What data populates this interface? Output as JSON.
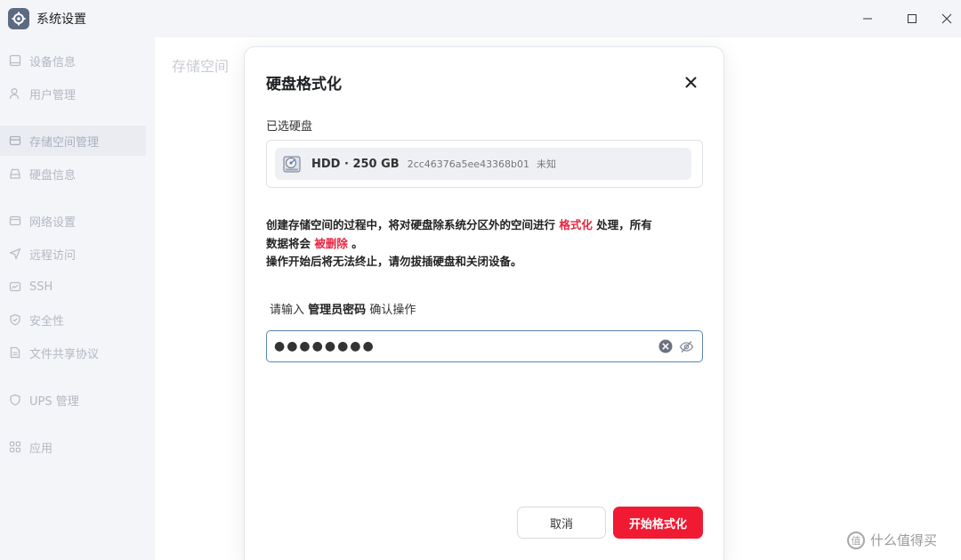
{
  "window": {
    "title": "系统设置",
    "minimize_icon": "minimize-icon",
    "maximize_icon": "maximize-icon",
    "close_icon": "close-icon"
  },
  "sidebar": {
    "items": [
      {
        "label": "设备信息",
        "icon": "device-icon",
        "active": false
      },
      {
        "label": "用户管理",
        "icon": "user-icon",
        "active": false
      },
      {
        "label": "存储空间管理",
        "icon": "storage-icon",
        "active": true
      },
      {
        "label": "硬盘信息",
        "icon": "disk-icon",
        "active": false
      },
      {
        "label": "网络设置",
        "icon": "network-icon",
        "active": false
      },
      {
        "label": "远程访问",
        "icon": "remote-access-icon",
        "active": false
      },
      {
        "label": "SSH",
        "icon": "ssh-icon",
        "active": false
      },
      {
        "label": "安全性",
        "icon": "shield-icon",
        "active": false
      },
      {
        "label": "文件共享协议",
        "icon": "file-share-icon",
        "active": false
      },
      {
        "label": "UPS 管理",
        "icon": "ups-icon",
        "active": false
      },
      {
        "label": "应用",
        "icon": "apps-icon",
        "active": false
      }
    ]
  },
  "content": {
    "title": "存储空间"
  },
  "modal": {
    "title": "硬盘格式化",
    "selected_label": "已选硬盘",
    "disk": {
      "name": "HDD · 250 GB",
      "id": "2cc46376a5ee43368b01",
      "status": "未知"
    },
    "warning": {
      "line1_prefix": "创建存储空间的过程中，将对硬盘除系统分区外的空间进行",
      "line1_highlight": "格式化",
      "line1_suffix": "处理，所有",
      "line2_prefix": "数据将会",
      "line2_highlight": "被删除",
      "line2_suffix": "。",
      "line3": "操作开始后将无法终止，请勿拔插硬盘和关闭设备。"
    },
    "password": {
      "label_prefix": "请输入",
      "label_bold": "管理员密码",
      "label_suffix": "确认操作",
      "value": "●●●●●●●●"
    },
    "cancel_label": "取消",
    "start_label": "开始格式化"
  },
  "watermark": {
    "logo_char": "值",
    "text": "什么值得买"
  },
  "colors": {
    "accent_red": "#f01a33",
    "input_border": "#5a86b0",
    "sidebar_bg": "#f4f5f8"
  }
}
